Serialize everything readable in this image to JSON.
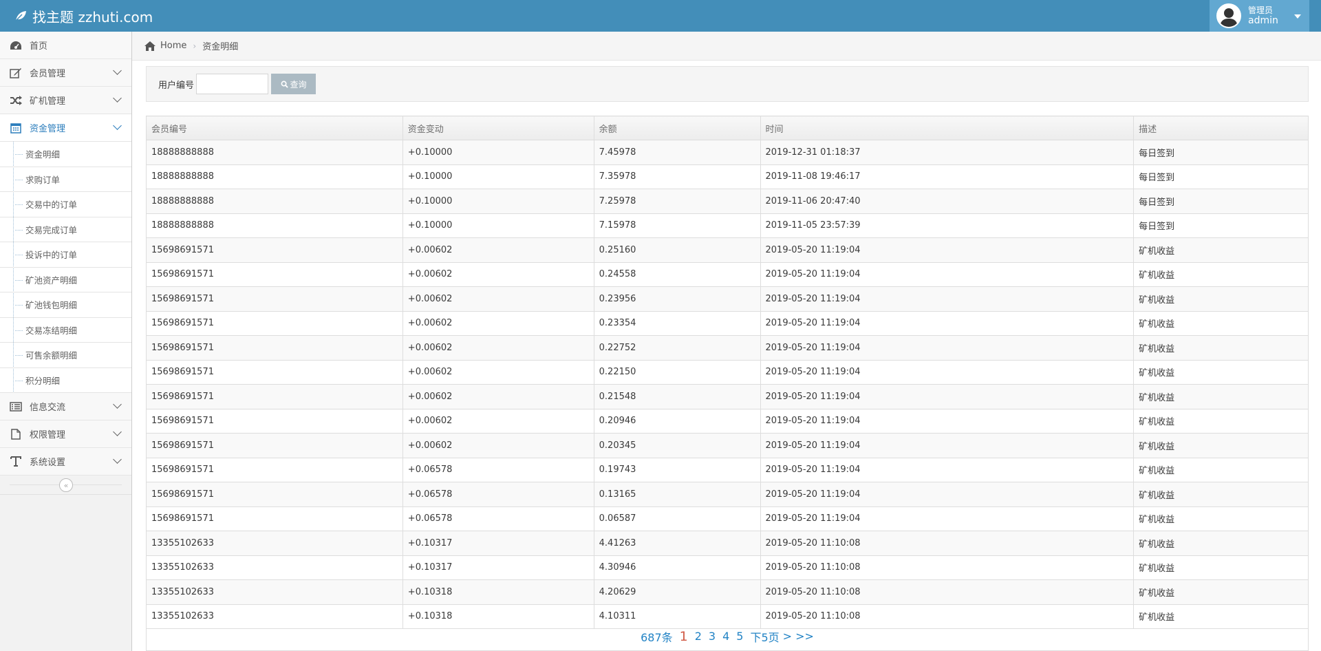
{
  "app": {
    "brand": "找主题 zzhuti.com",
    "user_role": "管理员",
    "user_name": "admin"
  },
  "sidebar": {
    "items": [
      {
        "label": "首页",
        "icon": "dashboard-icon"
      },
      {
        "label": "会员管理",
        "icon": "edit-icon"
      },
      {
        "label": "矿机管理",
        "icon": "random-icon"
      },
      {
        "label": "资金管理",
        "icon": "calendar-icon"
      },
      {
        "label": "信息交流",
        "icon": "list-icon"
      },
      {
        "label": "权限管理",
        "icon": "file-icon"
      },
      {
        "label": "系统设置",
        "icon": "text-icon"
      }
    ],
    "sub_items": [
      "资金明细",
      "求购订单",
      "交易中的订单",
      "交易完成订单",
      "投诉中的订单",
      "矿池资产明细",
      "矿池钱包明细",
      "交易冻结明细",
      "可售余额明细",
      "积分明细"
    ]
  },
  "breadcrumb": {
    "home": "Home",
    "current": "资金明细"
  },
  "search": {
    "label": "用户编号",
    "value": "",
    "button": "查询"
  },
  "table": {
    "headers": [
      "会员编号",
      "资金变动",
      "余额",
      "时间",
      "描述"
    ],
    "rows": [
      [
        "18888888888",
        "+0.10000",
        "7.45978",
        "2019-12-31 01:18:37",
        "每日签到"
      ],
      [
        "18888888888",
        "+0.10000",
        "7.35978",
        "2019-11-08 19:46:17",
        "每日签到"
      ],
      [
        "18888888888",
        "+0.10000",
        "7.25978",
        "2019-11-06 20:47:40",
        "每日签到"
      ],
      [
        "18888888888",
        "+0.10000",
        "7.15978",
        "2019-11-05 23:57:39",
        "每日签到"
      ],
      [
        "15698691571",
        "+0.00602",
        "0.25160",
        "2019-05-20 11:19:04",
        "矿机收益"
      ],
      [
        "15698691571",
        "+0.00602",
        "0.24558",
        "2019-05-20 11:19:04",
        "矿机收益"
      ],
      [
        "15698691571",
        "+0.00602",
        "0.23956",
        "2019-05-20 11:19:04",
        "矿机收益"
      ],
      [
        "15698691571",
        "+0.00602",
        "0.23354",
        "2019-05-20 11:19:04",
        "矿机收益"
      ],
      [
        "15698691571",
        "+0.00602",
        "0.22752",
        "2019-05-20 11:19:04",
        "矿机收益"
      ],
      [
        "15698691571",
        "+0.00602",
        "0.22150",
        "2019-05-20 11:19:04",
        "矿机收益"
      ],
      [
        "15698691571",
        "+0.00602",
        "0.21548",
        "2019-05-20 11:19:04",
        "矿机收益"
      ],
      [
        "15698691571",
        "+0.00602",
        "0.20946",
        "2019-05-20 11:19:04",
        "矿机收益"
      ],
      [
        "15698691571",
        "+0.00602",
        "0.20345",
        "2019-05-20 11:19:04",
        "矿机收益"
      ],
      [
        "15698691571",
        "+0.06578",
        "0.19743",
        "2019-05-20 11:19:04",
        "矿机收益"
      ],
      [
        "15698691571",
        "+0.06578",
        "0.13165",
        "2019-05-20 11:19:04",
        "矿机收益"
      ],
      [
        "15698691571",
        "+0.06578",
        "0.06587",
        "2019-05-20 11:19:04",
        "矿机收益"
      ],
      [
        "13355102633",
        "+0.10317",
        "4.41263",
        "2019-05-20 11:10:08",
        "矿机收益"
      ],
      [
        "13355102633",
        "+0.10317",
        "4.30946",
        "2019-05-20 11:10:08",
        "矿机收益"
      ],
      [
        "13355102633",
        "+0.10318",
        "4.20629",
        "2019-05-20 11:10:08",
        "矿机收益"
      ],
      [
        "13355102633",
        "+0.10318",
        "4.10311",
        "2019-05-20 11:10:08",
        "矿机收益"
      ]
    ]
  },
  "pager": {
    "total": "687条",
    "current": "1",
    "pages": [
      "2",
      "3",
      "4",
      "5"
    ],
    "next5": "下5页",
    "next": ">",
    "last": ">>"
  },
  "colors": {
    "navbar": "#438eb9",
    "user_box": "#62a8d1",
    "link": "#2283c5",
    "current_page": "#d15b47"
  }
}
